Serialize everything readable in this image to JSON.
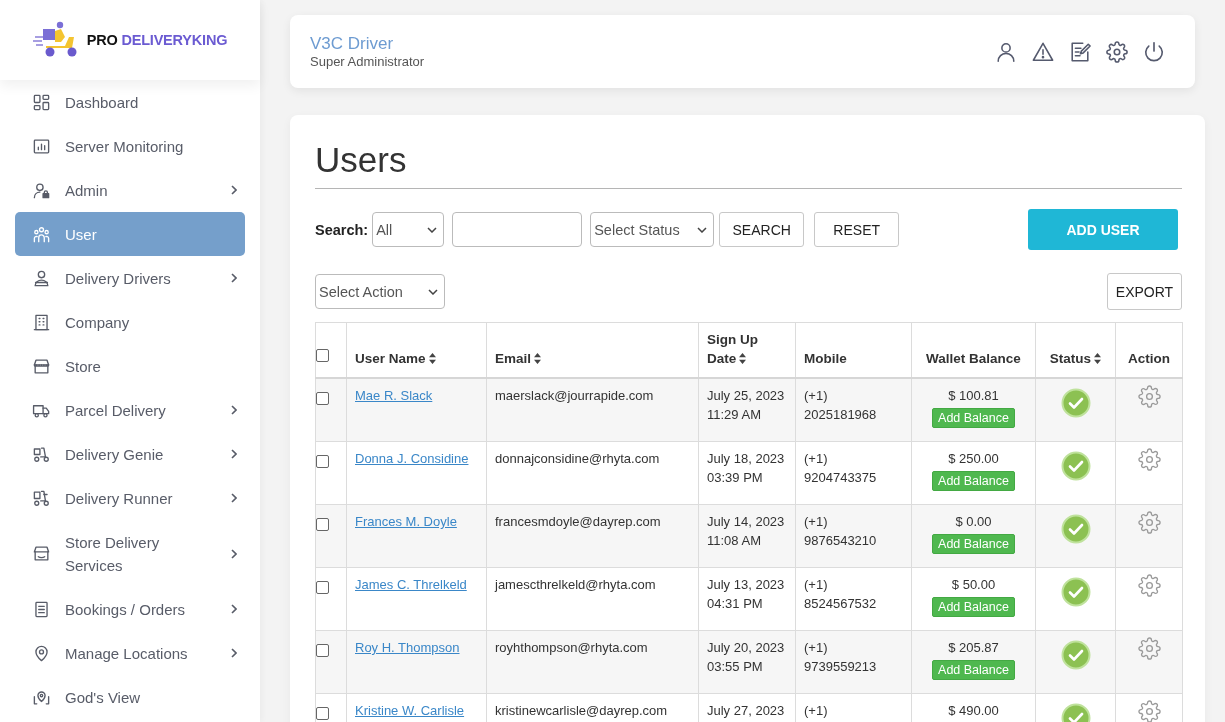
{
  "sidebar": {
    "logo": {
      "prefix": "PRO",
      "name": "DELIVERYKING"
    },
    "items": [
      {
        "label": "Dashboard",
        "submenu": false,
        "selected": false
      },
      {
        "label": "Server Monitoring",
        "submenu": false,
        "selected": false
      },
      {
        "label": "Admin",
        "submenu": true,
        "selected": false
      },
      {
        "label": "User",
        "submenu": false,
        "selected": true
      },
      {
        "label": "Delivery Drivers",
        "submenu": true,
        "selected": false
      },
      {
        "label": "Company",
        "submenu": false,
        "selected": false
      },
      {
        "label": "Store",
        "submenu": false,
        "selected": false
      },
      {
        "label": "Parcel Delivery",
        "submenu": true,
        "selected": false
      },
      {
        "label": "Delivery Genie",
        "submenu": true,
        "selected": false
      },
      {
        "label": "Delivery Runner",
        "submenu": true,
        "selected": false
      },
      {
        "label": "Store Delivery Services",
        "submenu": true,
        "selected": false
      },
      {
        "label": "Bookings / Orders",
        "submenu": true,
        "selected": false
      },
      {
        "label": "Manage Locations",
        "submenu": true,
        "selected": false
      },
      {
        "label": "God's View",
        "submenu": false,
        "selected": false
      }
    ]
  },
  "header": {
    "user_name": "V3C Driver",
    "role": "Super Administrator"
  },
  "page": {
    "title": "Users"
  },
  "toolbar": {
    "search_label": "Search:",
    "scope": "All",
    "status": "Select Status",
    "search_button": "SEARCH",
    "reset_button": "RESET",
    "add_button": "ADD USER",
    "bulk_action": "Select Action",
    "export_button": "EXPORT"
  },
  "table": {
    "all_checked": false,
    "columns": [
      {
        "label": "User Name",
        "sortable": true
      },
      {
        "label": "Email",
        "sortable": true
      },
      {
        "label": "Sign Up Date",
        "sortable": true
      },
      {
        "label": "Mobile",
        "sortable": false
      },
      {
        "label": "Wallet Balance",
        "sortable": false
      },
      {
        "label": "Status",
        "sortable": true
      },
      {
        "label": "Action",
        "sortable": false
      }
    ],
    "rows": [
      {
        "checked": false,
        "name": "Mae R. Slack",
        "email": "maerslack@jourrapide.com",
        "signup": "July 25, 2023 11:29 AM",
        "mobile": "(+1) 2025181968",
        "balance": "$ 100.81",
        "balance_action": "Add Balance",
        "active": true
      },
      {
        "checked": false,
        "name": "Donna J. Considine",
        "email": "donnajconsidine@rhyta.com",
        "signup": "July 18, 2023 03:39 PM",
        "mobile": "(+1) 9204743375",
        "balance": "$ 250.00",
        "balance_action": "Add Balance",
        "active": true
      },
      {
        "checked": false,
        "name": "Frances M. Doyle",
        "email": "francesmdoyle@dayrep.com",
        "signup": "July 14, 2023 11:08 AM",
        "mobile": "(+1) 9876543210",
        "balance": "$ 0.00",
        "balance_action": "Add Balance",
        "active": true
      },
      {
        "checked": false,
        "name": "James C. Threlkeld",
        "email": "jamescthrelkeld@rhyta.com",
        "signup": "July 13, 2023 04:31 PM",
        "mobile": "(+1) 8524567532",
        "balance": "$ 50.00",
        "balance_action": "Add Balance",
        "active": true
      },
      {
        "checked": false,
        "name": "Roy H. Thompson",
        "email": "royhthompson@rhyta.com",
        "signup": "July 20, 2023 03:55 PM",
        "mobile": "(+1) 9739559213",
        "balance": "$ 205.87",
        "balance_action": "Add Balance",
        "active": true
      },
      {
        "checked": false,
        "name": "Kristine W. Carlisle",
        "email": "kristinewcarlisle@dayrep.com",
        "signup": "July 27, 2023",
        "mobile": "(+1)",
        "balance": "$ 490.00",
        "active": true
      }
    ]
  }
}
